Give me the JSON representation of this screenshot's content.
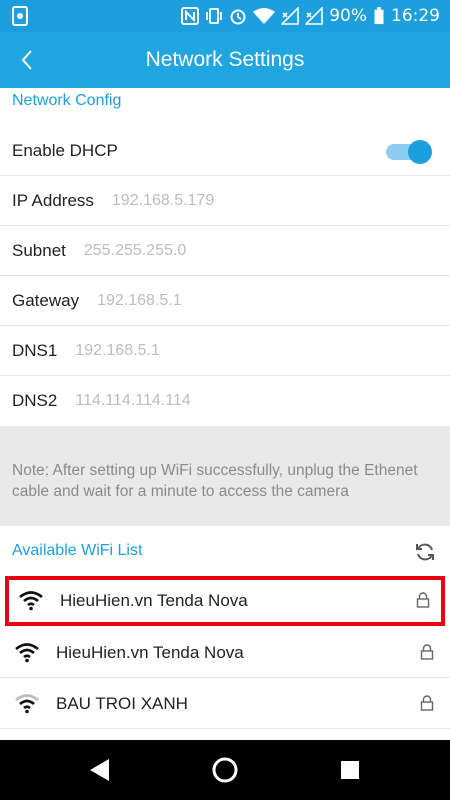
{
  "status_bar": {
    "battery": "90%",
    "time": "16:29",
    "icons": [
      "usb-debug-icon",
      "nfc-icon",
      "vibrate-icon",
      "alarm-icon",
      "wifi-icon",
      "signal-icon",
      "signal-icon",
      "battery-icon"
    ]
  },
  "app_bar": {
    "title": "Network Settings",
    "back_icon": "back-arrow-icon"
  },
  "network_config": {
    "section_label": "Network Config",
    "dhcp": {
      "label": "Enable DHCP",
      "enabled": true
    },
    "fields": [
      {
        "label": "IP Address",
        "value": "192.168.5.179"
      },
      {
        "label": "Subnet",
        "value": "255.255.255.0"
      },
      {
        "label": "Gateway",
        "value": "192.168.5.1"
      },
      {
        "label": "DNS1",
        "value": "192.168.5.1"
      },
      {
        "label": "DNS2",
        "value": "114.114.114.114"
      }
    ]
  },
  "note": "Note: After setting up WiFi successfully, unplug the Ethenet cable and wait for a minute to access the camera",
  "wifi": {
    "section_label": "Available WiFi List",
    "networks": [
      {
        "name": "HieuHien.vn Tenda Nova",
        "locked": true
      },
      {
        "name": "HieuHien.vn Tenda Nova",
        "locked": true
      },
      {
        "name": "BAU TROI XANH",
        "locked": true
      }
    ]
  },
  "colors": {
    "accent": "#1c9fdc",
    "highlight": "#e8000f",
    "note_bg": "#e9e9e9"
  }
}
